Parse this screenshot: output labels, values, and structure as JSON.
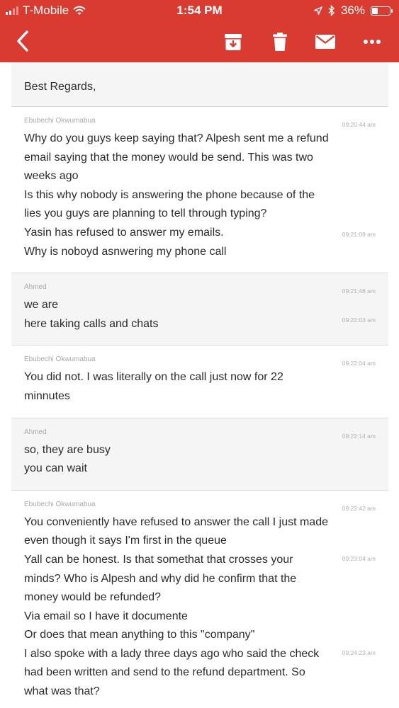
{
  "status_bar": {
    "carrier": "T-Mobile",
    "time": "1:54 PM",
    "battery": "36%",
    "battery_level": 0.36
  },
  "toolbar": {
    "back_icon": "chevron-left-icon",
    "actions": [
      "archive-icon",
      "trash-icon",
      "mail-icon",
      "more-icon"
    ]
  },
  "signature": "Best Regards,",
  "messages": [
    {
      "sender": "Ebubechi Okwumabua",
      "role": "customer",
      "lines": [
        "Why do you guys keep saying that? Alpesh sent me a refund",
        "email saying that the money would be send. This was two",
        "weeks ago",
        "Is this why nobody is answering the phone because of the",
        "lies you guys are planning to tell through typing?",
        "Yasin has refused to answer my emails.",
        "Why is noboyd asnwering my phone call"
      ],
      "ts1": "09:20:44 am",
      "ts2": "09:21:08 am"
    },
    {
      "sender": "Ahmed",
      "role": "agent",
      "lines": [
        "we are",
        "here taking calls and chats"
      ],
      "ts1": "09:21:48 am",
      "ts2": "09:22:03 am"
    },
    {
      "sender": "Ebubechi Okwumabua",
      "role": "customer",
      "lines": [
        "You did not. I was literally on the call just now for 22",
        "minnutes"
      ],
      "ts1": "09:22:04 am"
    },
    {
      "sender": "Ahmed",
      "role": "agent",
      "lines": [
        "so, they are busy",
        "you can wait"
      ],
      "ts1": "09:22:14 am"
    },
    {
      "sender": "Ebubechi Okwumabua",
      "role": "customer",
      "lines": [
        "You conveniently have refused to answer the call I just made",
        "even though it says I'm first in the queue",
        "Yall can be honest. Is that somethat that crosses your",
        "minds? Who is Alpesh and why did he confirm that the",
        "money would be refunded?",
        "Via email so I have it documente",
        "Or does that mean anything to this \"company\"",
        "I also spoke with a lady three days ago who said the check",
        "had been written and send to the refund department. So",
        "what was that?"
      ],
      "ts1": "09:22:42 am",
      "ts2": "09:23:04 am",
      "ts3": "09:24:23 am"
    }
  ]
}
